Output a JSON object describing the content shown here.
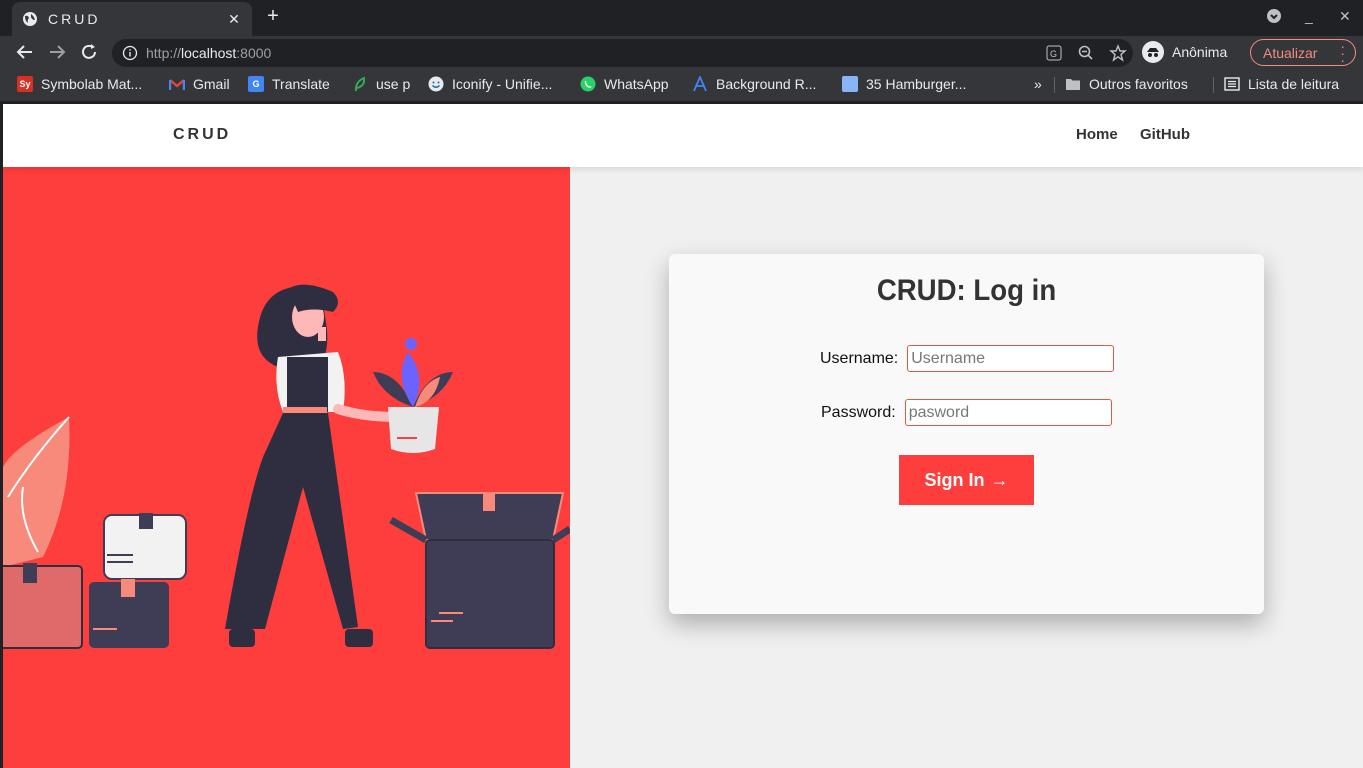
{
  "browser": {
    "tab_title": "CRUD",
    "url_scheme": "http://",
    "url_host": "localhost",
    "url_port": ":8000",
    "profile_name": "Anônima",
    "update_label": "Atualizar",
    "bookmarks": [
      {
        "label": "Symbolab Mat...",
        "icon": "Sy",
        "color": "#d93025"
      },
      {
        "label": "Gmail",
        "icon": "M",
        "color": "#ea4335"
      },
      {
        "label": "Translate",
        "icon": "G",
        "color": "#4285f4"
      },
      {
        "label": "use p",
        "icon": "leaf",
        "color": "#34a853"
      },
      {
        "label": "Iconify - Unifie...",
        "icon": "smile",
        "color": "#1769aa"
      },
      {
        "label": "WhatsApp",
        "icon": "whatsapp",
        "color": "#25d366"
      },
      {
        "label": "Background R...",
        "icon": "A",
        "color": "#4285f4"
      },
      {
        "label": "35 Hamburger...",
        "icon": "img",
        "color": "#8ab4f8"
      }
    ],
    "overflow_label": "»",
    "other_bookmarks": "Outros favoritos",
    "reading_list": "Lista de leitura"
  },
  "nav": {
    "brand": "CRUD",
    "links": [
      "Home",
      "GitHub"
    ]
  },
  "login": {
    "title": "CRUD: Log in",
    "username_label": "Username:",
    "username_placeholder": "Username",
    "password_label": "Password:",
    "password_placeholder": "pasword",
    "submit_label": "Sign In",
    "submit_icon": "→"
  },
  "colors": {
    "accent": "#fe3d3d",
    "figure_dark": "#2f2e41",
    "flower": "#6c63ff"
  }
}
